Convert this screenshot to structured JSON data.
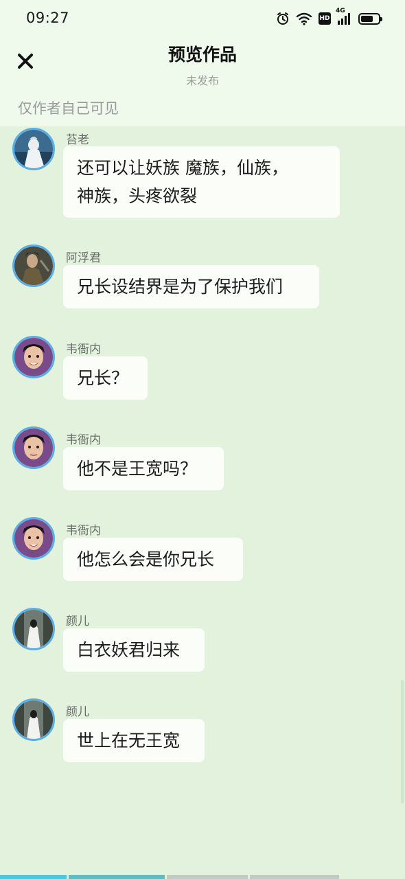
{
  "status_bar": {
    "time": "09:27",
    "hd_label": "HD",
    "network_label": "4G"
  },
  "header": {
    "title": "预览作品",
    "subtitle": "未发布",
    "visibility_note": "仅作者自己可见"
  },
  "messages": [
    {
      "sender": "苔老",
      "text_lines": [
        "还可以让妖族  魔族，仙族，",
        "神族，头疼欲裂"
      ]
    },
    {
      "sender": "阿浮君",
      "text_lines": [
        "兄长设结界是为了保护我们"
      ]
    },
    {
      "sender": "韦衙内",
      "text_lines": [
        "兄长？"
      ]
    },
    {
      "sender": "韦衙内",
      "text_lines": [
        "他不是王宽吗？"
      ]
    },
    {
      "sender": "韦衙内",
      "text_lines": [
        "他怎么会是你兄长"
      ]
    },
    {
      "sender": "颜儿",
      "text_lines": [
        "白衣妖君归来"
      ]
    },
    {
      "sender": "颜儿",
      "text_lines": [
        "世上在无王宽"
      ]
    }
  ],
  "icons": {
    "close": "close-icon",
    "alarm": "alarm-icon",
    "wifi": "wifi-icon",
    "signal": "signal-icon",
    "battery": "battery-icon"
  },
  "colors": {
    "header_bg": "#effaed",
    "chat_bg": "#e2f2dd",
    "bubble_bg": "#fbfdf9",
    "avatar_ring": "#5aaee8",
    "progress_active": "#4cc6d8"
  }
}
